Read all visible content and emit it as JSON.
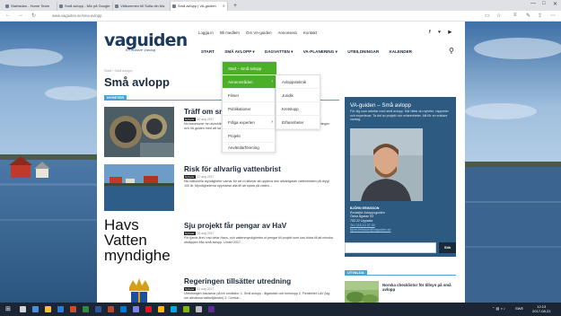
{
  "browser": {
    "tabs": [
      {
        "label": "Startsidan - Home Team"
      },
      {
        "label": "Små avlopp - Mix på Google"
      },
      {
        "label": "Välkommen till Sofia din Ma"
      },
      {
        "label": "Små avlopp | VA-guiden"
      }
    ],
    "new_tab": "+",
    "url": "www.vaguiden.se/sma-avlopp",
    "window_controls": [
      "—",
      "□",
      "✕"
    ]
  },
  "site": {
    "logo_va": "va",
    "logo_guiden": "guiden",
    "tagline": "En enklare Vardag",
    "top_links": [
      "Logga in",
      "Bli medlem",
      "Om VA-guiden",
      "Annonsera",
      "Kontakt"
    ],
    "social": [
      "f",
      "♥",
      "▶"
    ],
    "main_nav": [
      "START",
      "SMÅ AVLOPP ▾",
      "DAGVATTEN ▾",
      "VA-PLANERING ▾",
      "UTBILDNINGAR",
      "KALENDER"
    ]
  },
  "breadcrumb": "Start › Små avlopp",
  "page_title": "Små avlopp",
  "section_label": "NYHETER",
  "dropdown": {
    "level1": [
      "Start – Små avlopp",
      "Anneområden",
      "Filmer",
      "Publikationer",
      "Fråga experten",
      "Projekt",
      "Användarförening"
    ],
    "level2": [
      "Avloppsteknik",
      "Juridik",
      "Kretslopp",
      "Erfarenheter"
    ]
  },
  "articles": [
    {
      "title": "Träff om sm",
      "tag": "Nyheter",
      "date": "20 aug 2017",
      "text": "Nu kommuner he utveckling av tillsynsmetodik med s.k. surrogat anläggningar för användarföreningen och VA guiden med att ha informationsspridning..."
    },
    {
      "title": "Risk för allvarlig vattenbrist",
      "tag": "Nyheter",
      "date": "17 aug 2017",
      "text": "Nio nationella myndigheter varnar för att vi riskerar att uppleva den allvarligaste vattenbristen på drygt 100 år. Myndigheterna uppmanar alla till att spara på vatten..."
    },
    {
      "title": "Sju projekt får pengar av HaV",
      "tag": "Nyheter",
      "date": "15 aug 2017",
      "text": "För fjärde året i rad delar Havs- och vattenmyndigheten ut pengar till projekt som kan bidra till att minska utsläppen från små avlopp. Under 2017..."
    },
    {
      "title": "Regeringen tillsätter utredning",
      "tag": "Nyheter",
      "date": "11 aug 2017",
      "text": "Utredningen fokuserar på tre områden: 1. Små avlopp - ålgarstskt och kretslopp 2. Flexibilitet LAV (lag om allmänna vattentjänster) 3. Central..."
    }
  ],
  "havs_logo_lines": [
    "Havs",
    "Vatten",
    "myndighe"
  ],
  "sidebar": {
    "title": "VA-guiden – Små avlopp",
    "text": "För dig som arbetar med små avlopp. Här hittar du nyheter, rapporter och expertsvar. Ta del av projekt och erfarenheter. Allt för en enklare vardag.",
    "person_name": "BJÖRN ERIKSSON",
    "person_role": "Redaktör Avloppsguiden",
    "address1": "Östra Ågatan 53",
    "address2": "753 22 Uppsala",
    "phone": "Tel: 018-10 07 00",
    "email": "bjorn.eriksson@vaguiden.se",
    "search_button": "Sök",
    "utvalda_label": "UTVALDA",
    "utvalda_title": "Norska checklistor för tillsyn på små avlopp"
  },
  "taskbar": {
    "start": "⊞",
    "time": "12:13",
    "date": "2017-08-22",
    "lang": "SWE"
  },
  "colors": {
    "accent_green": "#4caf28",
    "accent_blue": "#4aa3d6",
    "navy": "#1b2a3a",
    "sidebar_blue": "#2d5a80"
  }
}
